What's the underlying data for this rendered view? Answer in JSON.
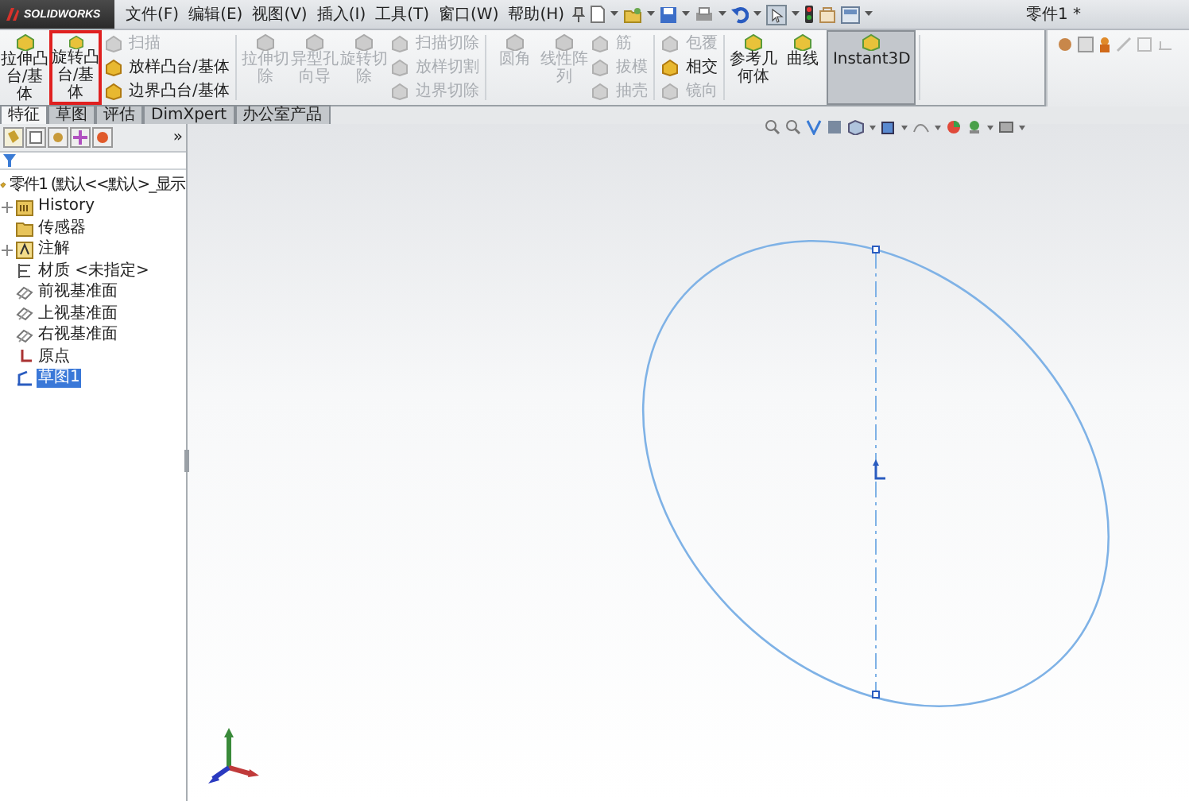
{
  "app": {
    "logo": "SOLIDWORKS",
    "title": "零件1 *"
  },
  "menus": [
    "文件(F)",
    "编辑(E)",
    "视图(V)",
    "插入(I)",
    "工具(T)",
    "窗口(W)",
    "帮助(H)"
  ],
  "ribbon": [
    {
      "large": [
        {
          "label": "拉伸凸台/基体",
          "disabled": false,
          "highlighted": false,
          "pressed": false
        },
        {
          "label": "旋转凸台/基体",
          "disabled": false,
          "highlighted": true,
          "pressed": false
        }
      ],
      "small": [
        {
          "label": "扫描",
          "disabled": true
        },
        {
          "label": "放样凸台/基体",
          "disabled": false
        },
        {
          "label": "边界凸台/基体",
          "disabled": false
        }
      ]
    },
    {
      "large": [
        {
          "label": "拉伸切除",
          "disabled": true,
          "highlighted": false,
          "pressed": false
        },
        {
          "label": "异型孔向导",
          "disabled": true,
          "highlighted": false,
          "pressed": false
        },
        {
          "label": "旋转切除",
          "disabled": true,
          "highlighted": false,
          "pressed": false
        }
      ],
      "small": [
        {
          "label": "扫描切除",
          "disabled": true
        },
        {
          "label": "放样切割",
          "disabled": true
        },
        {
          "label": "边界切除",
          "disabled": true
        }
      ]
    },
    {
      "large": [
        {
          "label": "圆角",
          "disabled": true,
          "highlighted": false,
          "pressed": false
        },
        {
          "label": "线性阵列",
          "disabled": true,
          "highlighted": false,
          "pressed": false
        }
      ],
      "small": [
        {
          "label": "筋",
          "disabled": true
        },
        {
          "label": "拔模",
          "disabled": true
        },
        {
          "label": "抽壳",
          "disabled": true
        }
      ]
    },
    {
      "small": [
        {
          "label": "包覆",
          "disabled": true
        },
        {
          "label": "相交",
          "disabled": false
        },
        {
          "label": "镜向",
          "disabled": true
        }
      ]
    },
    {
      "large": [
        {
          "label": "参考几何体",
          "disabled": false,
          "highlighted": false,
          "pressed": false
        },
        {
          "label": "曲线",
          "disabled": false,
          "highlighted": false,
          "pressed": false
        },
        {
          "label": "Instant3D",
          "disabled": false,
          "highlighted": false,
          "pressed": true
        }
      ]
    }
  ],
  "tabs": [
    {
      "label": "特征",
      "selected": true
    },
    {
      "label": "草图",
      "selected": false
    },
    {
      "label": "评估",
      "selected": false
    },
    {
      "label": "DimXpert",
      "selected": false
    },
    {
      "label": "办公室产品",
      "selected": false
    }
  ],
  "panel_more": "»",
  "tree": [
    {
      "label": "零件1 (默认<<默认>_显示",
      "kind": "part",
      "selected": false,
      "children": [
        {
          "label": "History",
          "kind": "history",
          "expander": true,
          "selected": false
        },
        {
          "label": "传感器",
          "kind": "folder",
          "expander": false,
          "selected": false
        },
        {
          "label": "注解",
          "kind": "note",
          "expander": true,
          "selected": false
        },
        {
          "label": "材质 <未指定>",
          "kind": "material",
          "expander": false,
          "selected": false
        },
        {
          "label": "前视基准面",
          "kind": "plane",
          "expander": false,
          "selected": false
        },
        {
          "label": "上视基准面",
          "kind": "plane",
          "expander": false,
          "selected": false
        },
        {
          "label": "右视基准面",
          "kind": "plane",
          "expander": false,
          "selected": false
        },
        {
          "label": "原点",
          "kind": "origin",
          "expander": false,
          "selected": false
        },
        {
          "label": "草图1",
          "kind": "sketch",
          "expander": false,
          "selected": true
        }
      ]
    }
  ]
}
